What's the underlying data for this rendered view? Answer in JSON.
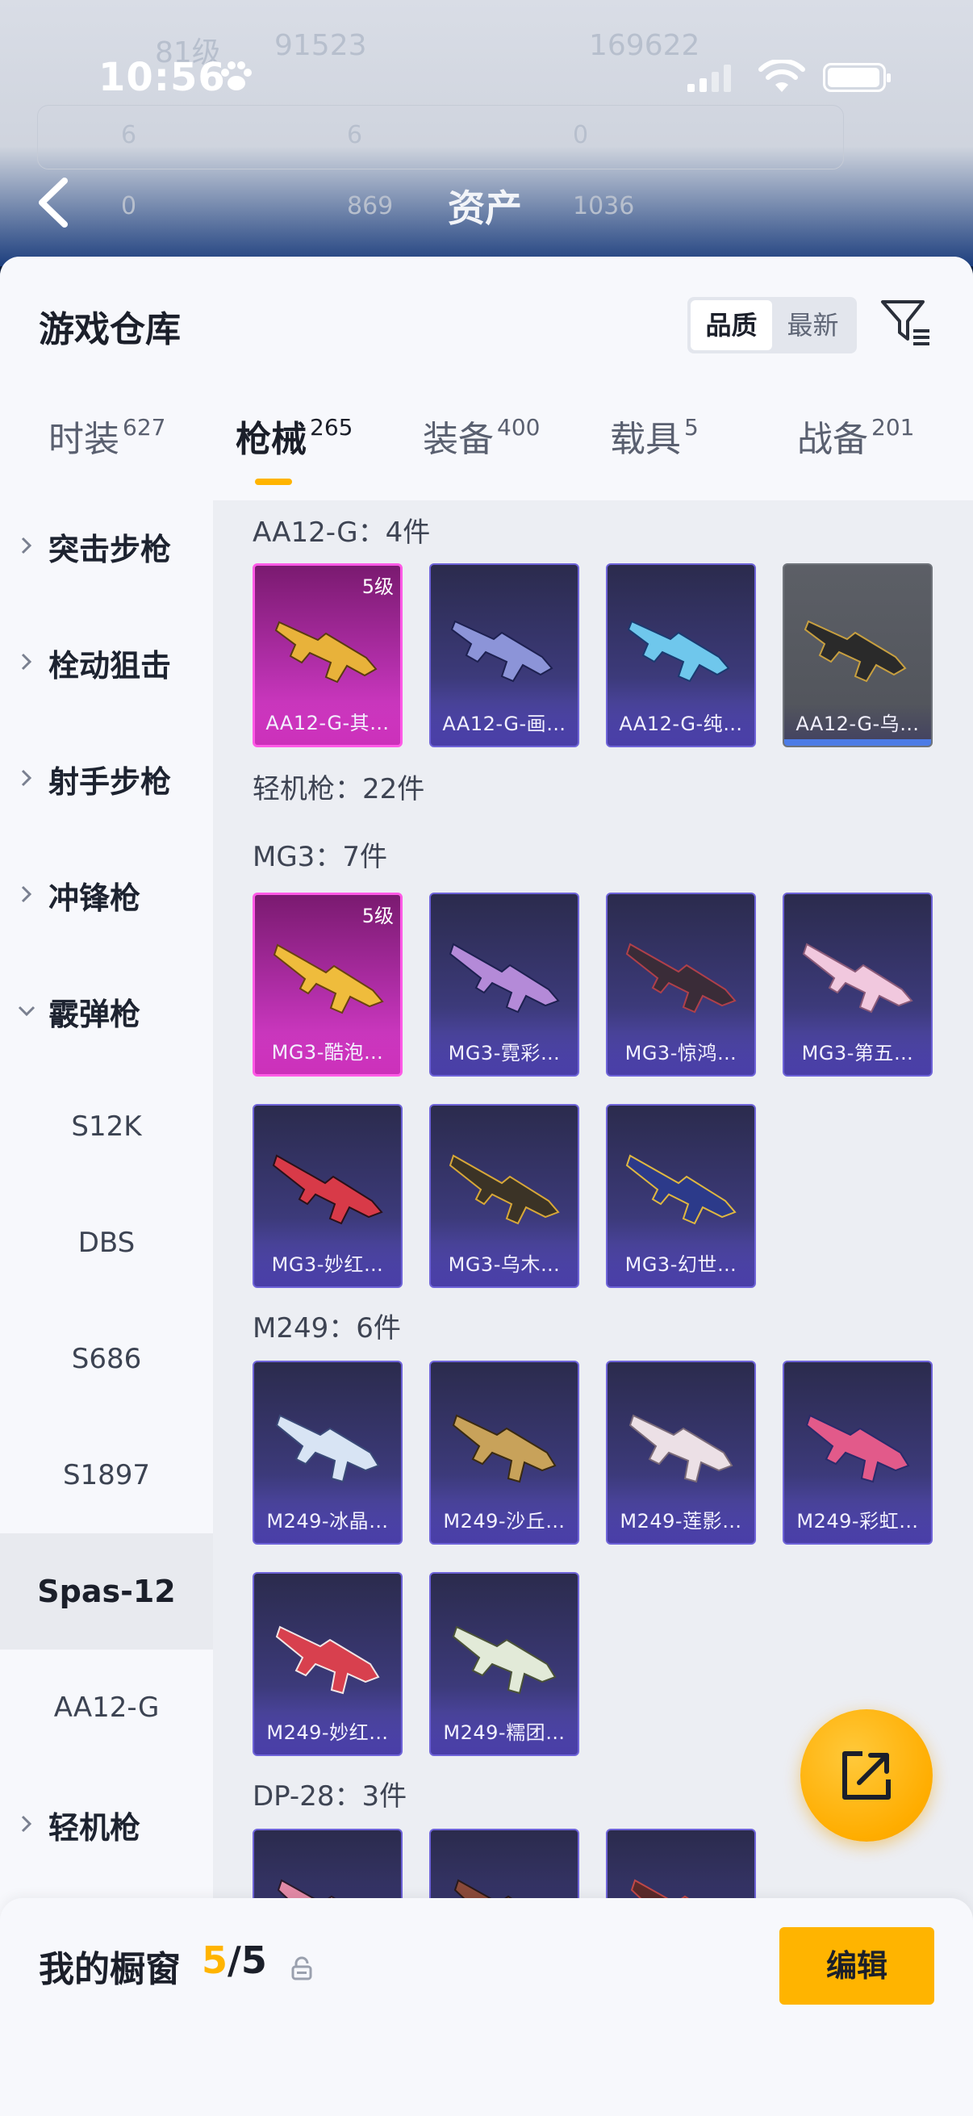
{
  "status_bar": {
    "time": "10:56"
  },
  "background": {
    "title": "资产",
    "faded_texts": [
      "81级",
      "91523",
      "169622",
      "6",
      "6",
      "0",
      "0",
      "869",
      "1036"
    ]
  },
  "sheet": {
    "title": "游戏仓库",
    "sort": {
      "quality": "品质",
      "newest": "最新"
    },
    "tabs": [
      {
        "label": "时装",
        "count": "627"
      },
      {
        "label": "枪械",
        "count": "265"
      },
      {
        "label": "装备",
        "count": "400"
      },
      {
        "label": "载具",
        "count": "5"
      },
      {
        "label": "战备",
        "count": "201"
      }
    ]
  },
  "categories": [
    {
      "label": "突击步枪"
    },
    {
      "label": "栓动狙击"
    },
    {
      "label": "射手步枪"
    },
    {
      "label": "冲锋枪"
    },
    {
      "label": "霰弹枪"
    }
  ],
  "shotgun_subs": [
    "S12K",
    "DBS",
    "S686",
    "S1897",
    "Spas-12",
    "AA12-G"
  ],
  "last_category": {
    "label": "轻机枪"
  },
  "groups": {
    "aa12": {
      "title": "AA12-G：4件",
      "items": [
        "AA12-G-其…",
        "AA12-G-画…",
        "AA12-G-纯…",
        "AA12-G-乌…"
      ]
    },
    "lmg": {
      "title": "轻机枪：22件"
    },
    "mg3": {
      "title": "MG3：7件",
      "items": [
        "MG3-酷泡…",
        "MG3-霓彩…",
        "MG3-惊鸿…",
        "MG3-第五…",
        "MG3-妙红…",
        "MG3-乌木…",
        "MG3-幻世…"
      ]
    },
    "m249": {
      "title": "M249：6件",
      "items": [
        "M249-冰晶…",
        "M249-沙丘…",
        "M249-莲影…",
        "M249-彩虹…",
        "M249-妙红…",
        "M249-糯团…"
      ]
    },
    "dp28": {
      "title": "DP-28：3件"
    }
  },
  "level_badge": "5级",
  "showcase": {
    "label": "我的橱窗",
    "current": "5",
    "total": "/5",
    "edit": "编辑"
  },
  "colors": {
    "accent": "#ffb400",
    "gold_card": "#e23fd2",
    "purple_card": "#5b4fc6"
  }
}
